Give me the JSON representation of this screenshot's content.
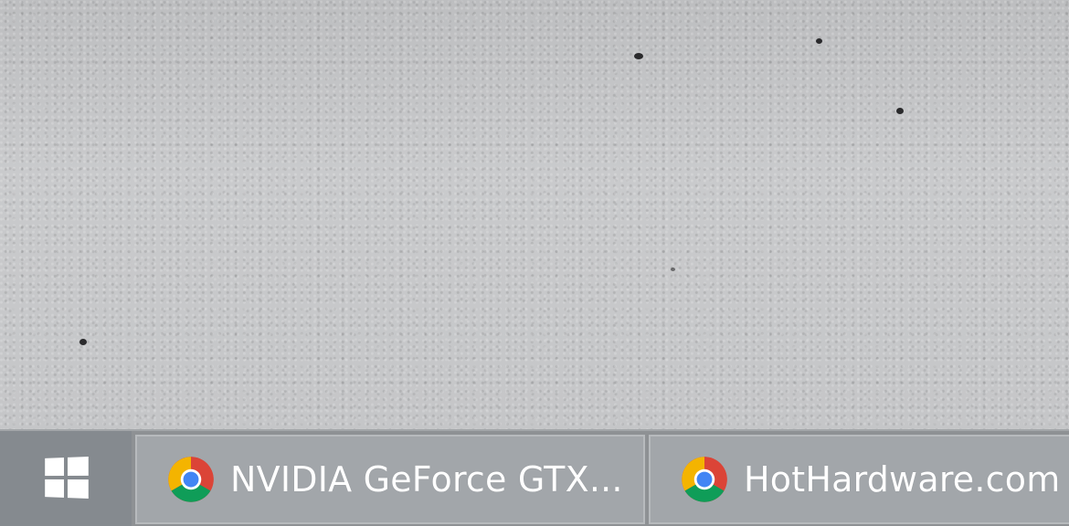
{
  "taskbar": {
    "start_icon": "windows-logo-icon",
    "buttons": [
      {
        "icon": "chrome-icon",
        "label": "NVIDIA GeForce GTX..."
      },
      {
        "icon": "chrome-icon",
        "label": "HotHardware.com"
      }
    ]
  },
  "colors": {
    "desktop_background": "#c4c5c7",
    "taskbar_background": "#8e9194",
    "start_button_background": "#858a8f",
    "task_button_background": "#a2a6aa",
    "label_text": "#ffffff"
  }
}
